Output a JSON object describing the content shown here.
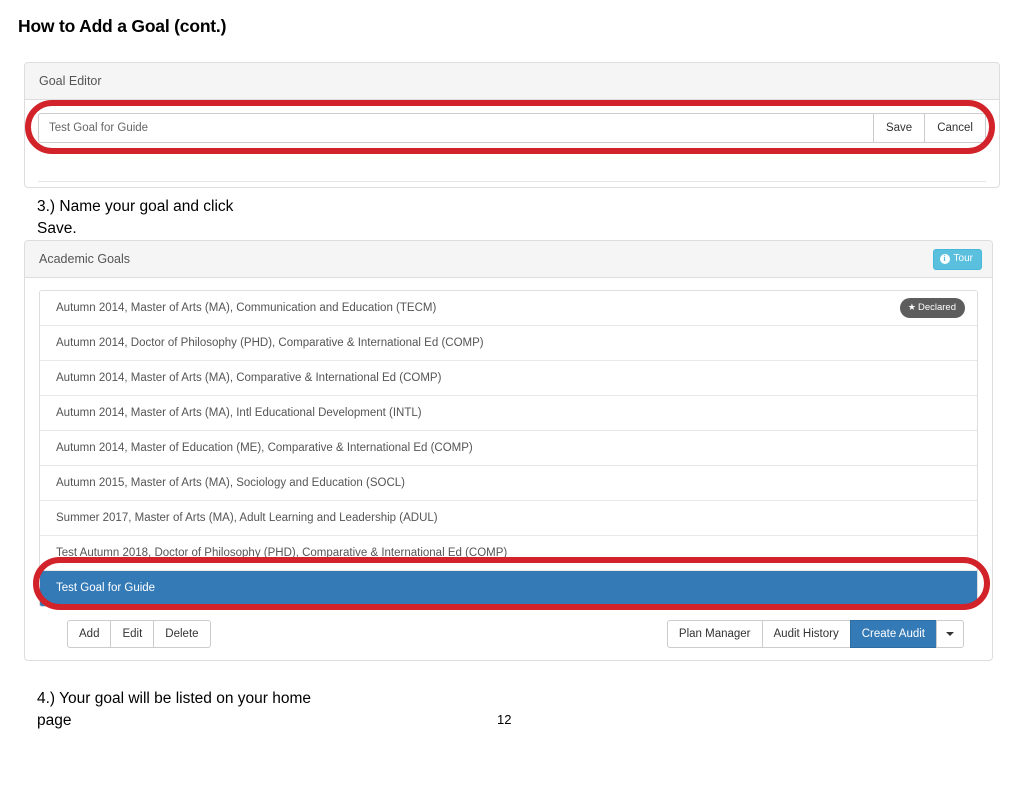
{
  "slide": {
    "title": "How to Add a Goal (cont.)",
    "page_number": "12"
  },
  "captions": {
    "step3": "3.) Name your goal and click\nSave.",
    "step4": "4.) Your goal will be listed on your home\npage"
  },
  "goal_editor": {
    "panel_title": "Goal Editor",
    "input_value": "Test Goal for Guide",
    "input_placeholder": "Test Goal for Guide",
    "save_label": "Save",
    "cancel_label": "Cancel"
  },
  "academic_goals": {
    "panel_title": "Academic Goals",
    "tour_label": "Tour",
    "tour_icon": "info-circle-icon",
    "tour_color": "#5bc0de",
    "declared_badge": {
      "label": "Declared",
      "icon": "star-icon",
      "glyph": "★",
      "color": "#5d5d5d"
    },
    "selected_color": "#337ab7",
    "rows": [
      {
        "text": "Autumn 2014, Master of Arts (MA), Communication and Education (TECM)",
        "declared": true,
        "selected": false
      },
      {
        "text": "Autumn 2014, Doctor of Philosophy (PHD), Comparative & International Ed (COMP)",
        "declared": false,
        "selected": false
      },
      {
        "text": "Autumn 2014, Master of Arts (MA), Comparative & International Ed (COMP)",
        "declared": false,
        "selected": false
      },
      {
        "text": "Autumn 2014, Master of Arts (MA), Intl Educational Development (INTL)",
        "declared": false,
        "selected": false
      },
      {
        "text": "Autumn 2014, Master of Education (ME), Comparative & International Ed (COMP)",
        "declared": false,
        "selected": false
      },
      {
        "text": "Autumn 2015, Master of Arts (MA), Sociology and Education (SOCL)",
        "declared": false,
        "selected": false
      },
      {
        "text": "Summer 2017, Master of Arts (MA), Adult Learning and Leadership (ADUL)",
        "declared": false,
        "selected": false
      },
      {
        "text": "Test Autumn 2018, Doctor of Philosophy (PHD), Comparative & International Ed (COMP)",
        "declared": false,
        "selected": false
      },
      {
        "text": "Test Goal for Guide",
        "declared": false,
        "selected": true
      }
    ],
    "left_buttons": [
      {
        "label": "Add",
        "style": "default"
      },
      {
        "label": "Edit",
        "style": "default"
      },
      {
        "label": "Delete",
        "style": "default"
      }
    ],
    "right_buttons": [
      {
        "label": "Plan Manager",
        "style": "default"
      },
      {
        "label": "Audit History",
        "style": "default"
      },
      {
        "label": "Create Audit",
        "style": "primary"
      }
    ],
    "caret_icon": "chevron-down-icon"
  },
  "annotations": {
    "color": "#d2222a",
    "shapes": [
      {
        "name": "goal-editor-input-highlight"
      },
      {
        "name": "new-goal-row-highlight"
      }
    ]
  }
}
